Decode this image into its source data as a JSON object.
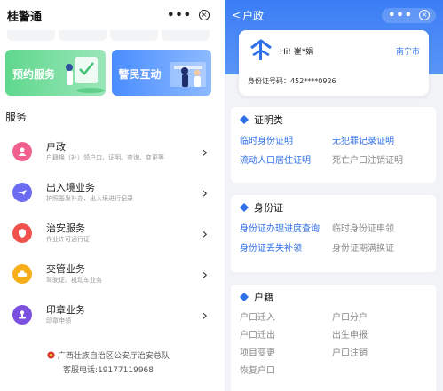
{
  "left": {
    "header": {
      "title": "桂警通",
      "more": "•••",
      "close": "×"
    },
    "banners": [
      {
        "label": "预约服务",
        "color": "#5fd88d"
      },
      {
        "label": "警民互动",
        "color": "#4a8dff"
      }
    ],
    "section_title": "服务",
    "services": [
      {
        "name": "户政",
        "desc": "户籍换（补）领户口、证明、查询、变更等",
        "icon": "household-icon",
        "color": "#f0628d"
      },
      {
        "name": "出入境业务",
        "desc": "护照签发补办、出入境进行记录",
        "icon": "plane-icon",
        "color": "#6c6cf2"
      },
      {
        "name": "治安服务",
        "desc": "作业许可通行证",
        "icon": "shield-icon",
        "color": "#f1514d"
      },
      {
        "name": "交管业务",
        "desc": "驾驶证、机动车业务",
        "icon": "car-icon",
        "color": "#f7ae1b"
      },
      {
        "name": "印章业务",
        "desc": "印章申领",
        "icon": "seal-icon",
        "color": "#7b4fe0"
      }
    ],
    "footer": {
      "org": "广西壮族自治区公安厅治安总队",
      "tel": "客服电话:19177119968"
    }
  },
  "right": {
    "header": {
      "back": "<",
      "title": "户政",
      "more": "•••",
      "close": "×"
    },
    "id_card": {
      "greeting": "Hi! 崔*娟",
      "city": "南宁市",
      "id_number": "身份证号码：452****0926"
    },
    "cards": [
      {
        "title": "证明类",
        "links": [
          {
            "text": "临时身份证明",
            "active": true
          },
          {
            "text": "无犯罪记录证明",
            "active": true
          },
          {
            "text": "流动人口居住证明",
            "active": true
          },
          {
            "text": "死亡户口注销证明",
            "active": false
          }
        ]
      },
      {
        "title": "身份证",
        "links": [
          {
            "text": "身份证办理进度查询",
            "active": true
          },
          {
            "text": "临时身份证申领",
            "active": false
          },
          {
            "text": "身份证丢失补领",
            "active": true
          },
          {
            "text": "身份证期满换证",
            "active": false
          }
        ]
      },
      {
        "title": "户籍",
        "links": [
          {
            "text": "户口迁入",
            "active": false
          },
          {
            "text": "户口分户",
            "active": false
          },
          {
            "text": "户口迁出",
            "active": false
          },
          {
            "text": "出生申报",
            "active": false
          },
          {
            "text": "项目变更",
            "active": false
          },
          {
            "text": "户口注销",
            "active": false
          },
          {
            "text": "恢复户口",
            "active": false
          }
        ]
      }
    ],
    "accent": "#3b7df5"
  }
}
